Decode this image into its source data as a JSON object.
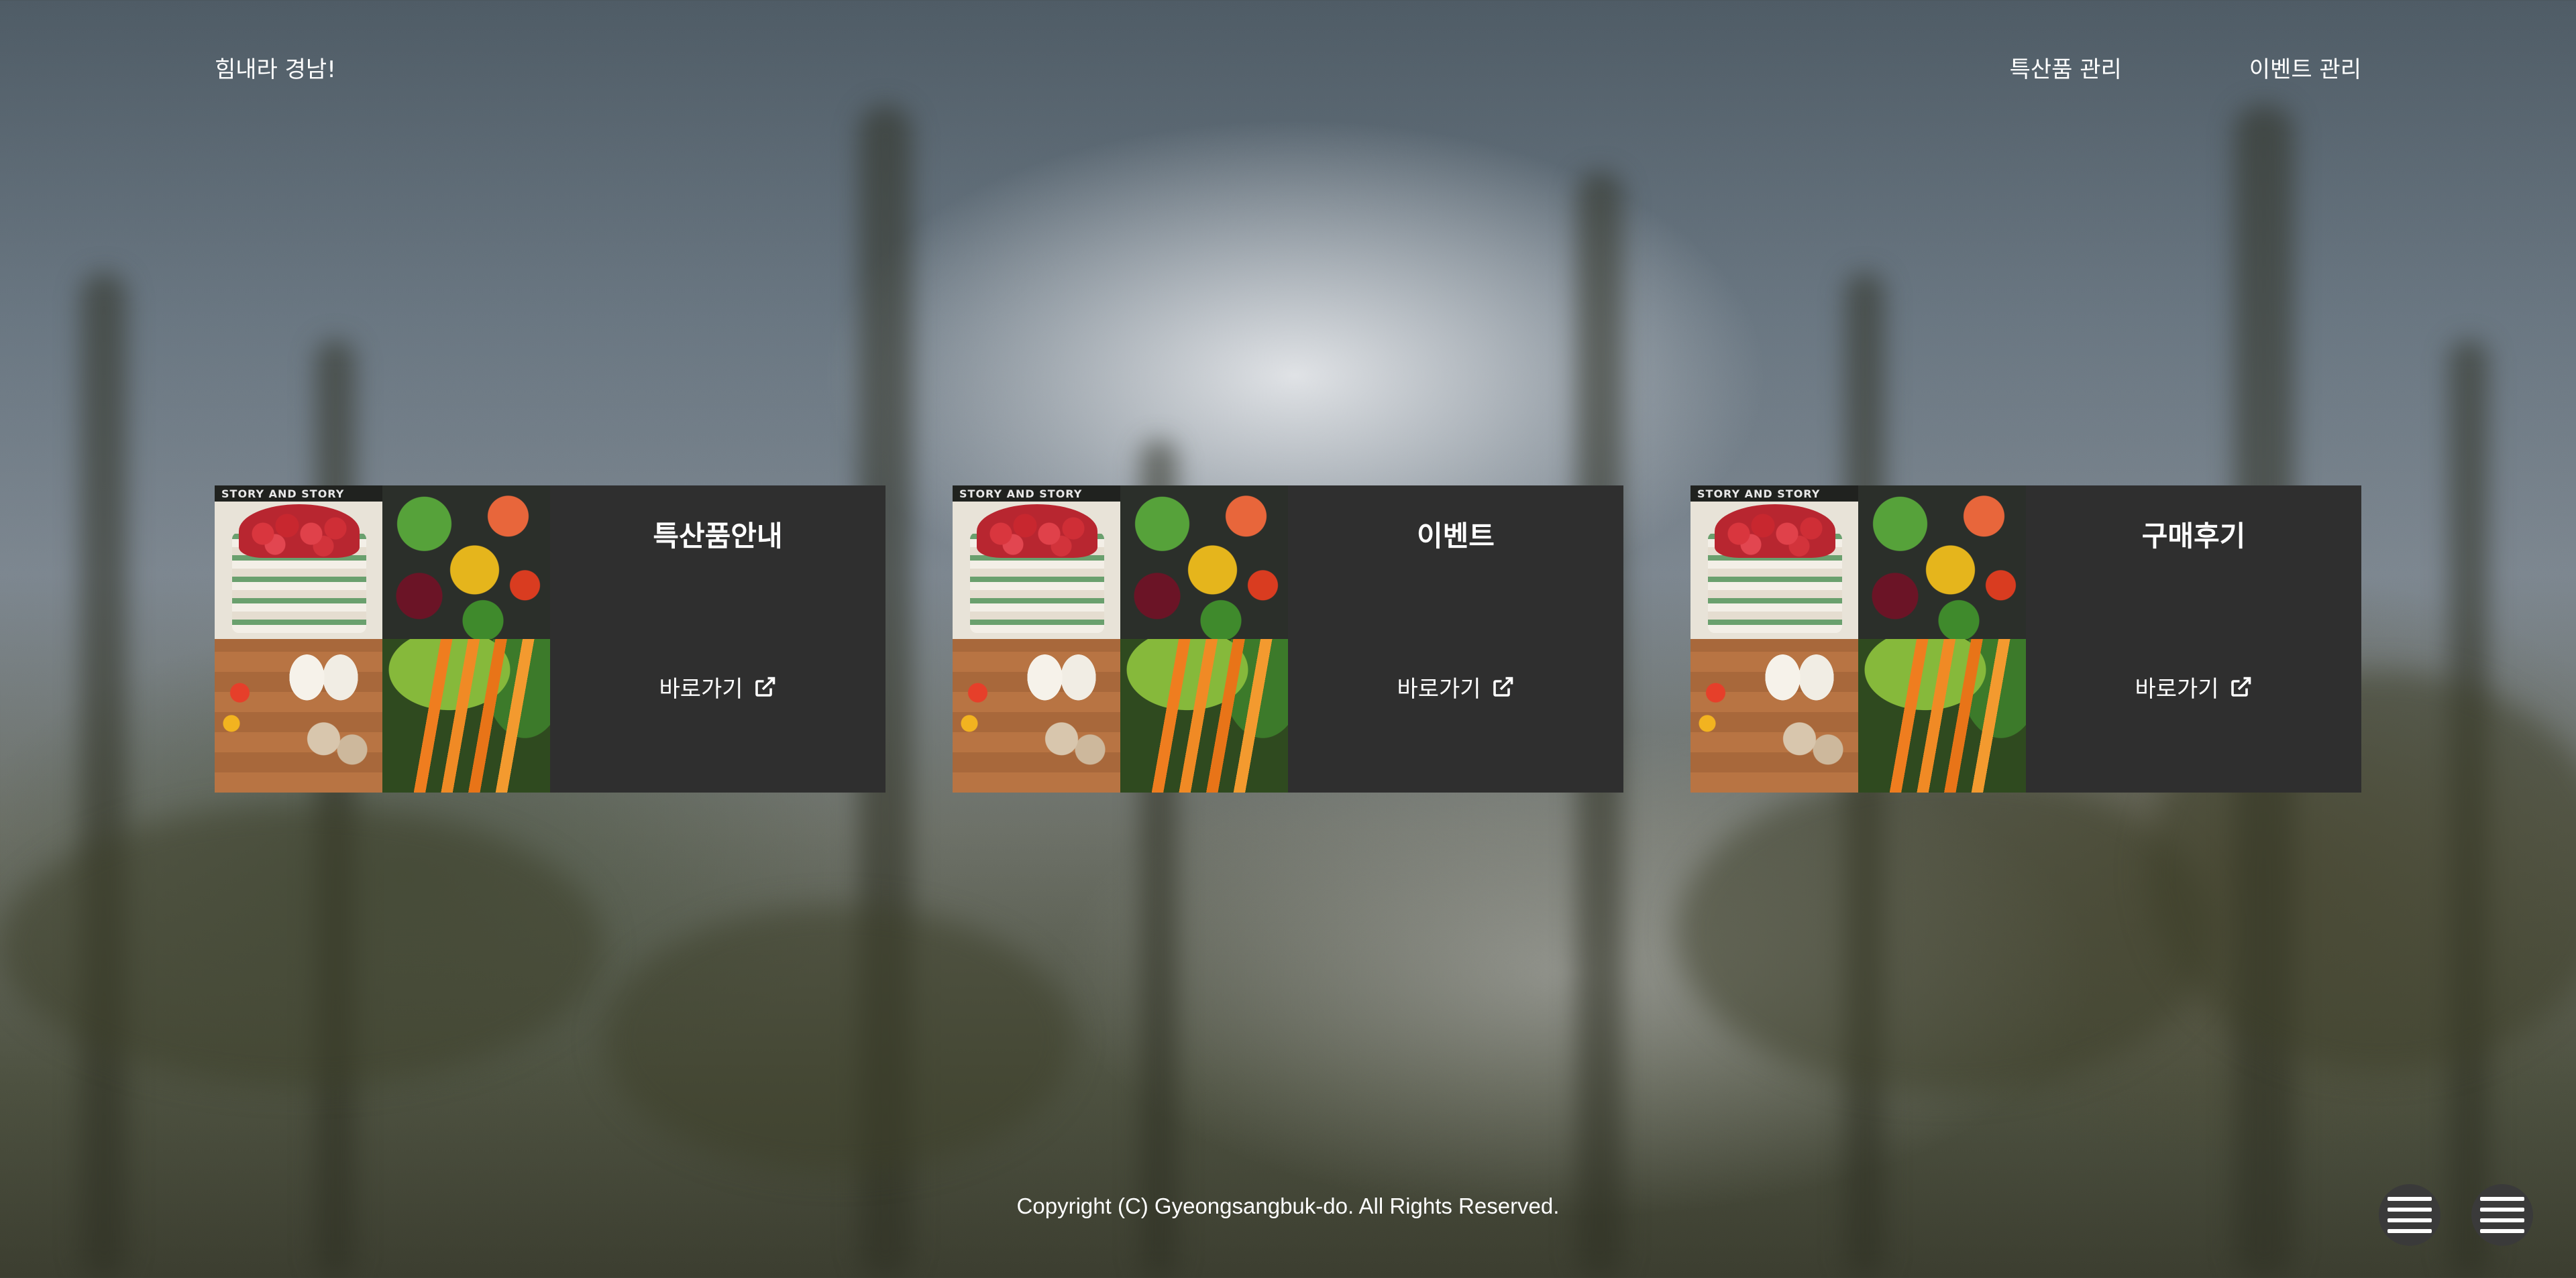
{
  "header": {
    "brand": "힘내라 경남!",
    "nav": [
      {
        "label": "특산품 관리"
      },
      {
        "label": "이벤트 관리"
      }
    ]
  },
  "cards": [
    {
      "title": "특산품안내",
      "link_label": "바로가기",
      "image_text": "STORY AND STORY"
    },
    {
      "title": "이벤트",
      "link_label": "바로가기",
      "image_text": "STORY AND STORY"
    },
    {
      "title": "구매후기",
      "link_label": "바로가기",
      "image_text": "STORY AND STORY"
    }
  ],
  "icons": {
    "link": "external-link-icon",
    "menu": "hamburger-menu-icon"
  },
  "footer": {
    "copyright": "Copyright (C) Gyeongsangbuk-do. All Rights Reserved."
  },
  "colors": {
    "card_bg": "#2f2f2f",
    "text": "#ffffff",
    "fab_bg": "#3a3a3a"
  }
}
